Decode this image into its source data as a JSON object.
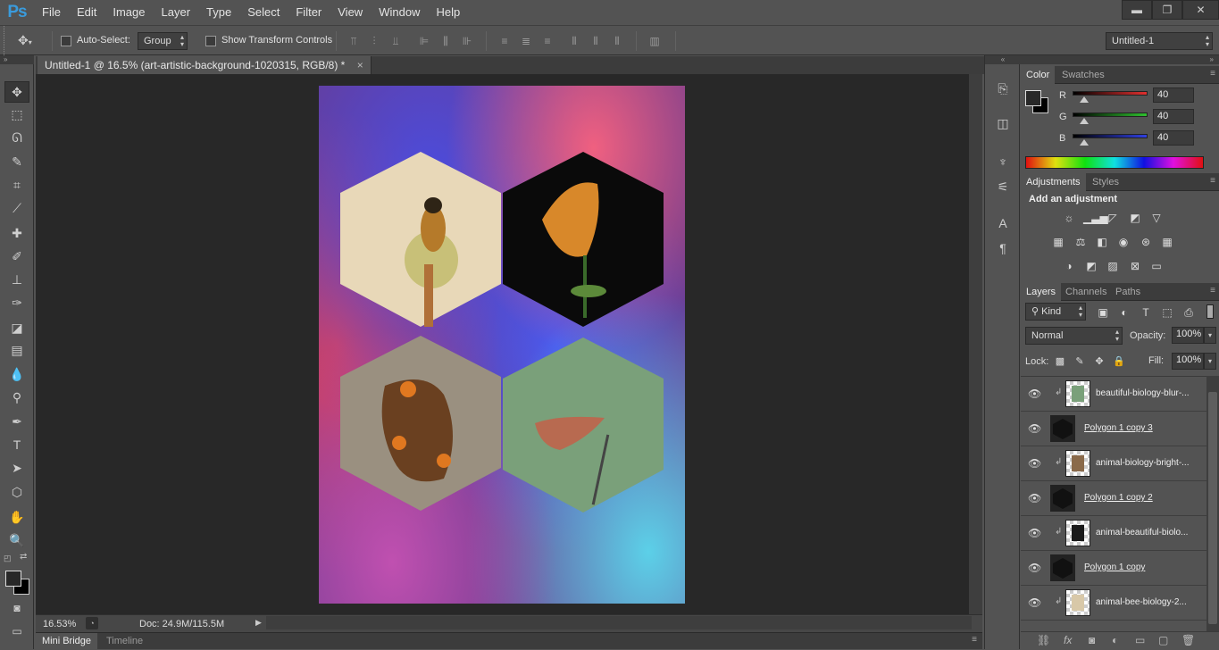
{
  "app": {
    "logo": "Ps"
  },
  "menu": [
    "File",
    "Edit",
    "Image",
    "Layer",
    "Type",
    "Select",
    "Filter",
    "View",
    "Window",
    "Help"
  ],
  "window_buttons": {
    "minimize": "▬",
    "restore": "❐",
    "close": "✕"
  },
  "options_bar": {
    "auto_select_label": "Auto-Select:",
    "auto_select_value": "Group",
    "show_transform_label": "Show Transform Controls",
    "workspace_value": "Untitled-1"
  },
  "document": {
    "tab_title": "Untitled-1 @ 16.5% (art-artistic-background-1020315, RGB/8) *",
    "zoom": "16.53%",
    "doc_size": "Doc: 24.9M/115.5M"
  },
  "bottom_tabs": [
    "Mini Bridge",
    "Timeline"
  ],
  "color_panel": {
    "tabs": [
      "Color",
      "Swatches"
    ],
    "channels": [
      {
        "label": "R",
        "value": "40",
        "color": "#e0302f"
      },
      {
        "label": "G",
        "value": "40",
        "color": "#2fbf2f"
      },
      {
        "label": "B",
        "value": "40",
        "color": "#2f3fe0"
      }
    ]
  },
  "adjustments_panel": {
    "tabs": [
      "Adjustments",
      "Styles"
    ],
    "title": "Add an adjustment",
    "rows": [
      [
        "brightness-icon",
        "levels-icon",
        "curves-icon",
        "exposure-icon",
        "vibrance-icon"
      ],
      [
        "hue-sat-icon",
        "color-balance-icon",
        "bw-icon",
        "photo-filter-icon",
        "channel-mixer-icon",
        "color-lookup-icon"
      ],
      [
        "invert-icon",
        "posterize-icon",
        "threshold-icon",
        "selective-color-icon",
        "gradient-map-icon"
      ]
    ]
  },
  "layers_panel": {
    "tabs": [
      "Layers",
      "Channels",
      "Paths"
    ],
    "kind_label": "Kind",
    "blend_mode": "Normal",
    "opacity_label": "Opacity:",
    "opacity": "100%",
    "lock_label": "Lock:",
    "fill_label": "Fill:",
    "fill": "100%",
    "layers": [
      {
        "name": "beautiful-biology-blur-...",
        "clipped": true,
        "shape": false,
        "thumb": "#7aa07a"
      },
      {
        "name": "Polygon 1 copy 3",
        "clipped": false,
        "shape": true,
        "thumb": "#222"
      },
      {
        "name": "animal-biology-bright-...",
        "clipped": true,
        "shape": false,
        "thumb": "#8a6a4a"
      },
      {
        "name": "Polygon 1 copy 2",
        "clipped": false,
        "shape": true,
        "thumb": "#222"
      },
      {
        "name": "animal-beautiful-biolo...",
        "clipped": true,
        "shape": false,
        "thumb": "#1a1a1a"
      },
      {
        "name": "Polygon 1 copy",
        "clipped": false,
        "shape": true,
        "thumb": "#222"
      },
      {
        "name": "animal-bee-biology-2...",
        "clipped": true,
        "shape": false,
        "thumb": "#d8c8a8"
      }
    ]
  }
}
